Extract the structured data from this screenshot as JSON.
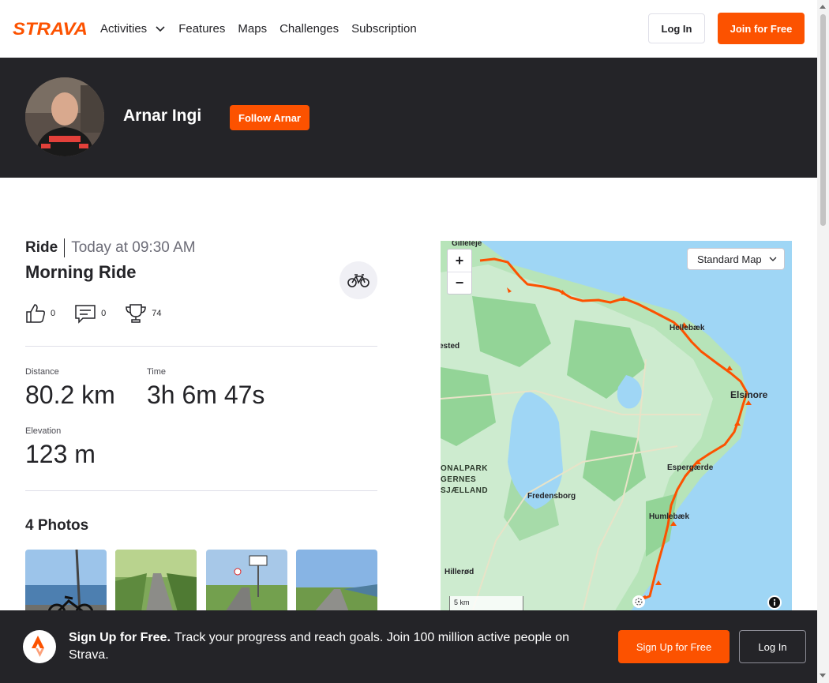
{
  "nav": {
    "brand": "STRAVA",
    "links": [
      {
        "label": "Activities",
        "has_dropdown": true
      },
      {
        "label": "Features"
      },
      {
        "label": "Maps"
      },
      {
        "label": "Challenges"
      },
      {
        "label": "Subscription"
      }
    ],
    "login_label": "Log In",
    "join_label": "Join for Free"
  },
  "athlete": {
    "name": "Arnar Ingi",
    "follow_label": "Follow Arnar"
  },
  "activity": {
    "type": "Ride",
    "date": "Today at 09:30 AM",
    "title": "Morning Ride",
    "sport_icon": "bike-icon",
    "kudos": "0",
    "comments": "0",
    "achievements": "74",
    "stats": {
      "distance_label": "Distance",
      "distance_value": "80.2 km",
      "time_label": "Time",
      "time_value": "3h 6m 47s",
      "elevation_label": "Elevation",
      "elevation_value": "123 m"
    },
    "photos_title": "4 Photos"
  },
  "map": {
    "style_label": "Standard Map",
    "zoom_in": "+",
    "zoom_out": "−",
    "scale_label": "5 km",
    "labels": {
      "gilleleje": "Gilleleje",
      "hellebaek": "Hellebæk",
      "elsinore": "Elsinore",
      "espergaerde": "Espergærde",
      "humlebaek": "Humlebæk",
      "fredensborg": "Fredensborg",
      "hillerod": "Hillerød",
      "sted": "ested",
      "park1": "ONALPARK",
      "park2": "GERNES",
      "park3": "SJÆLLAND"
    },
    "colors": {
      "route": "#fc5200",
      "land": "#b7e4b9",
      "water": "#9fd6f5"
    }
  },
  "banner": {
    "headline": "Sign Up for Free.",
    "text": "Track your progress and reach goals. Join 100 million active people on Strava.",
    "signup_label": "Sign Up for Free",
    "login_label": "Log In"
  },
  "colors": {
    "accent": "#fc5200",
    "dark": "#242428"
  }
}
